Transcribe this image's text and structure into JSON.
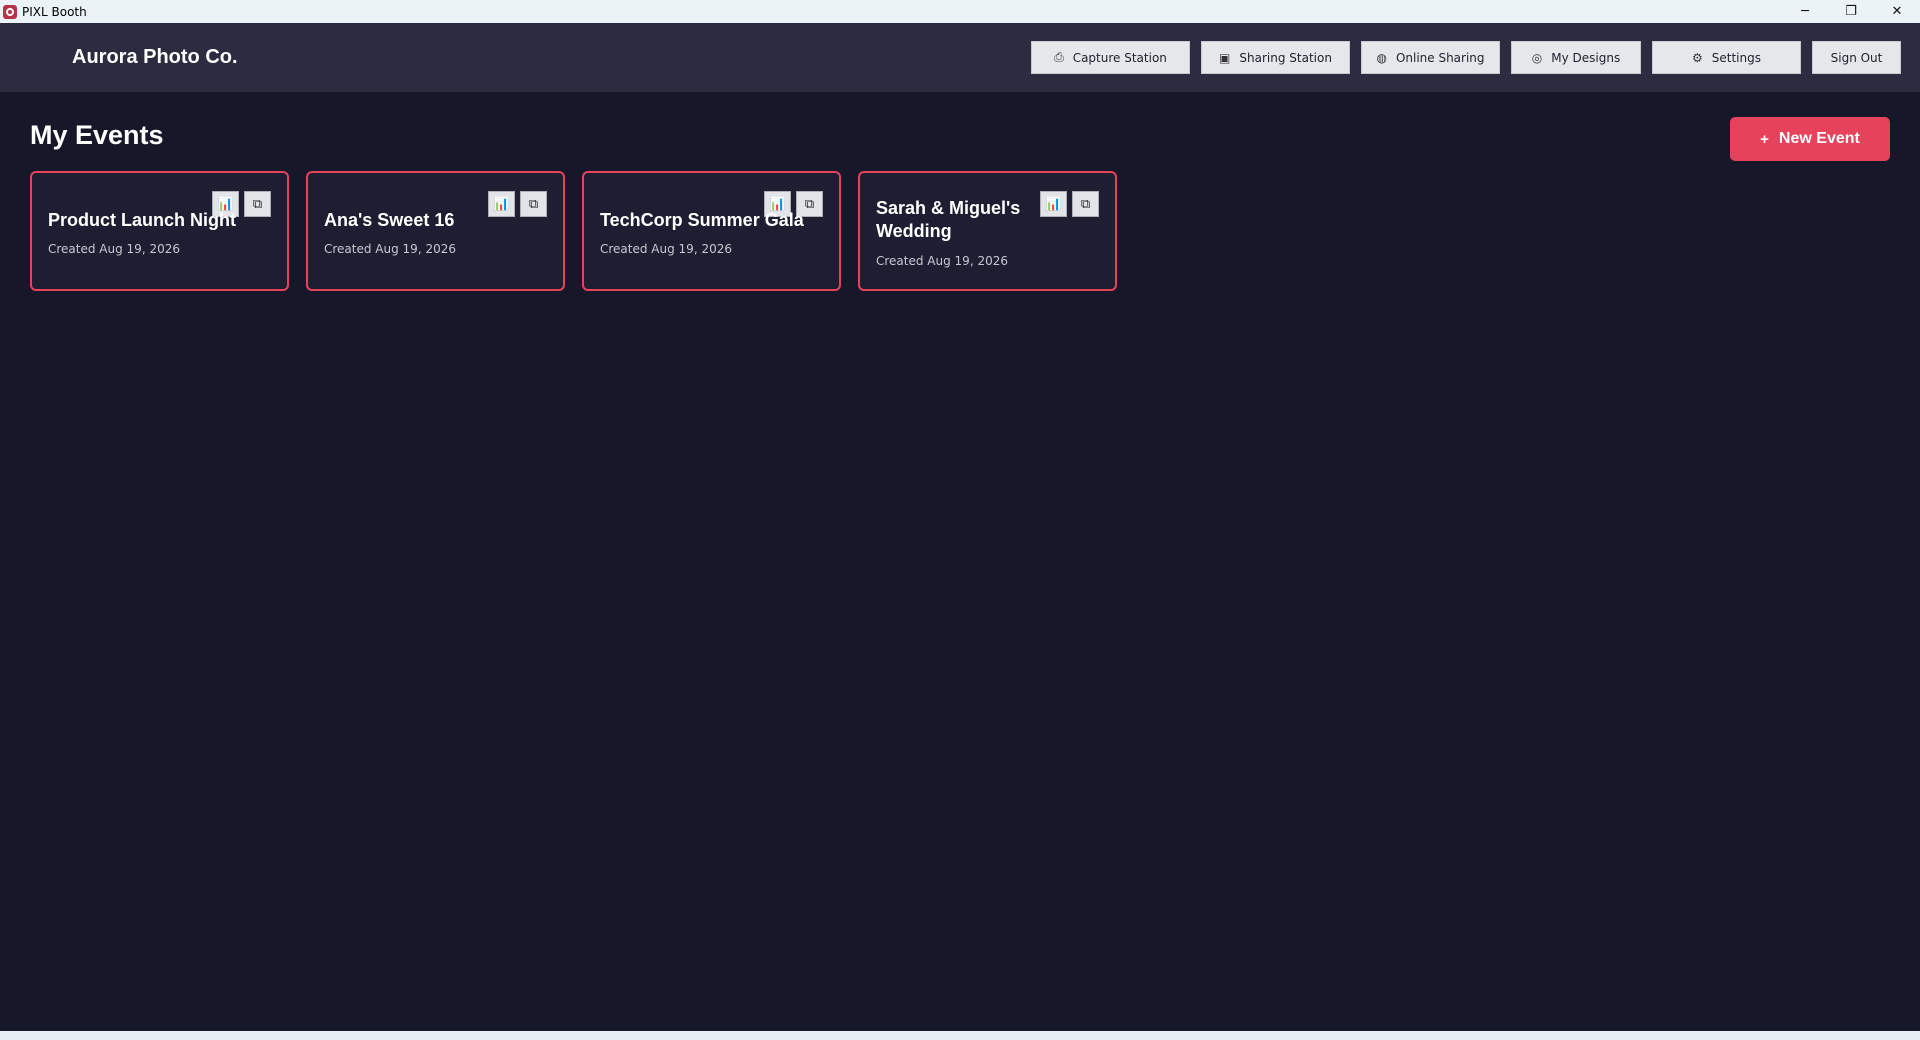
{
  "window": {
    "title": "PIXL Booth",
    "controls": {
      "minimize": "─",
      "restore": "❐",
      "close": "✕"
    }
  },
  "header": {
    "brand": "Aurora Photo Co.",
    "nav": [
      {
        "icon": "camera-icon",
        "glyph": "⎙",
        "label": "Capture Station"
      },
      {
        "icon": "image-icon",
        "glyph": "▣",
        "label": "Sharing Station"
      },
      {
        "icon": "globe-icon",
        "glyph": "◍",
        "label": "Online Sharing"
      },
      {
        "icon": "palette-icon",
        "glyph": "◎",
        "label": "My Designs"
      },
      {
        "icon": "gear-icon",
        "glyph": "⚙",
        "label": "Settings"
      },
      {
        "label": "Sign Out"
      }
    ]
  },
  "main": {
    "title": "My Events",
    "new_event": {
      "icon": "plus-icon",
      "glyph": "+",
      "label": "New Event"
    },
    "events": [
      {
        "name": "Product Launch Night",
        "created": "Created Aug 19, 2026"
      },
      {
        "name": "Ana's Sweet 16",
        "created": "Created Aug 19, 2026"
      },
      {
        "name": "TechCorp Summer Gala",
        "created": "Created Aug 19, 2026"
      },
      {
        "name": "Sarah & Miguel's Wedding",
        "created": "Created Aug 19, 2026"
      }
    ],
    "card_actions": {
      "stats": {
        "icon": "bar-chart-icon",
        "glyph": "📊"
      },
      "duplicate": {
        "icon": "duplicate-icon",
        "glyph": "⧉"
      }
    }
  },
  "colors": {
    "background": "#161728",
    "header": "#2b2c40",
    "accent": "#e7425c",
    "card": "#1d1e31"
  }
}
